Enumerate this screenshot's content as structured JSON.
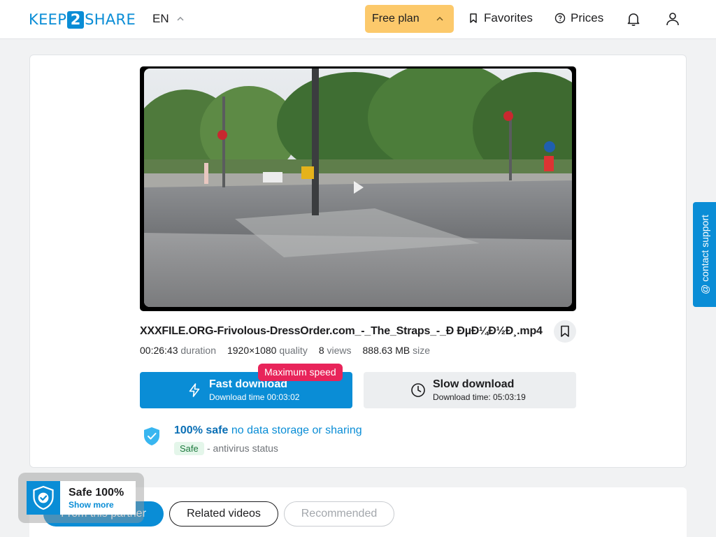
{
  "header": {
    "logo": {
      "left": "KEEP",
      "mid": "2",
      "right": "SHARE"
    },
    "language": "EN",
    "plan_label": "Free plan",
    "favorites_label": "Favorites",
    "prices_label": "Prices"
  },
  "file": {
    "title": "XXXFILE.ORG-Frivolous-DressOrder.com_-_The_Straps_-_Ð ÐµÐ¼Ð½Ð¸.mp4",
    "duration": "00:26:43",
    "duration_label": "duration",
    "quality": "1920×1080",
    "quality_label": "quality",
    "views": "8",
    "views_label": "views",
    "size": "888.63 MB",
    "size_label": "size"
  },
  "download": {
    "fast_label": "Fast download",
    "fast_time": "Download time 00:03:02",
    "max_badge": "Maximum speed",
    "slow_label": "Slow download",
    "slow_time": "Download time: 05:03:19"
  },
  "safety": {
    "headline": "100% safe",
    "headline_rest": "no data storage or sharing",
    "tag": "Safe",
    "status_text": "- antivirus status"
  },
  "support_label": "@ contact support",
  "tabs": [
    {
      "label": "From this partner",
      "active": true
    },
    {
      "label": "Related videos",
      "active": false
    },
    {
      "label": "Recommended",
      "active": false
    }
  ],
  "safe_widget": {
    "title": "Safe 100%",
    "link": "Show more"
  },
  "colors": {
    "accent": "#0a8dd6",
    "plan": "#fcc96b",
    "badge": "#e8245a"
  }
}
